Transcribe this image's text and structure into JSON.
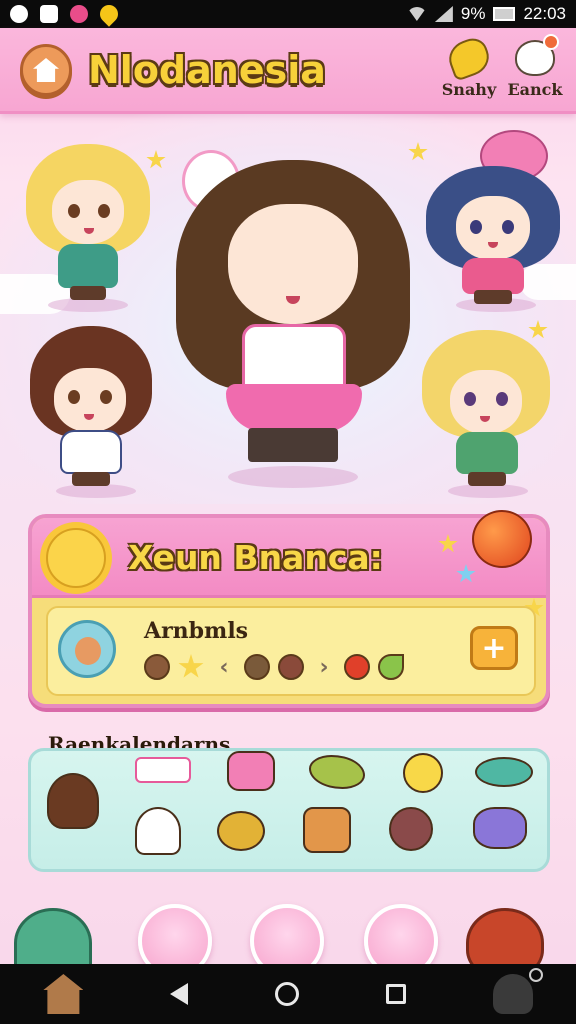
{
  "status_bar": {
    "battery": "9%",
    "time": "22:03"
  },
  "header": {
    "title": "Nlodanesia",
    "buttons": [
      {
        "label": "Snahy",
        "icon": "snack-icon"
      },
      {
        "label": "Eanck",
        "icon": "ranch-icon"
      }
    ]
  },
  "panel": {
    "title": "Xeun Bnanca:",
    "subtitle": "Arnbmls",
    "items": [
      "seed",
      "star",
      "arrow-left",
      "nut",
      "acorn",
      "arrow-right",
      "apple",
      "leaf"
    ],
    "add_label": "+"
  },
  "collection": {
    "title": "Raenkalendarns",
    "row1": [
      "girl",
      "sign",
      "candy",
      "pickle",
      "lemon",
      "dish"
    ],
    "row2": [
      "ghost",
      "tortoise",
      "bucket",
      "bug",
      "blob"
    ]
  },
  "colors": {
    "header_bg": "#f7a6d2",
    "title_fill": "#f7d13a",
    "title_outline": "#5b3a14",
    "panel_bg": "#f6dd7a",
    "collection_bg": "#d7f5ef"
  }
}
